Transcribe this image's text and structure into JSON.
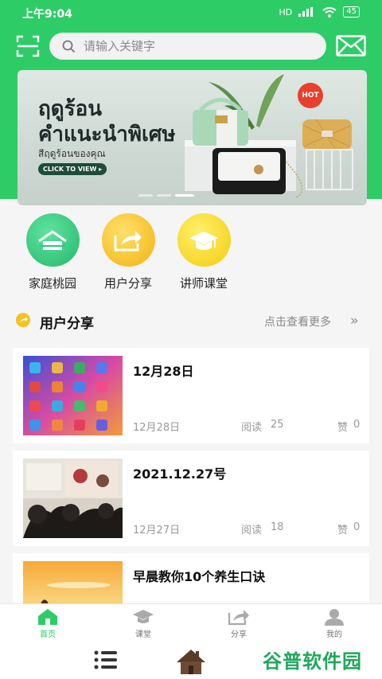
{
  "status_bar": {
    "time": "上午9:04",
    "network": "HD",
    "battery": "45"
  },
  "search": {
    "placeholder": "请输入关键字"
  },
  "banner": {
    "title_line1": "ฤดูร้อน",
    "title_line2": "คำแนะนำพิเศษ",
    "subtitle": "สีฤดูร้อนของคุณ",
    "cta": "CLICK TO VIEW",
    "badge": "HOT"
  },
  "quick_entries": [
    {
      "label": "家庭桃园",
      "icon": "house-icon",
      "color": "#2dc87a"
    },
    {
      "label": "用户分享",
      "icon": "share-icon",
      "color": "#f5be1d"
    },
    {
      "label": "讲师课堂",
      "icon": "graduation-cap-icon",
      "color": "#f5d51d"
    }
  ],
  "section": {
    "title": "用户分享",
    "more": "点击查看更多"
  },
  "posts": [
    {
      "title": "12月28日",
      "date": "12月28日",
      "read_label": "阅读",
      "reads": "25",
      "like_label": "赞",
      "likes": "0"
    },
    {
      "title": "2021.12.27号",
      "date": "12月27日",
      "read_label": "阅读",
      "reads": "18",
      "like_label": "赞",
      "likes": "0"
    },
    {
      "title": "早晨教你10个养生口诀"
    }
  ],
  "bottom_nav": [
    {
      "label": "首页",
      "icon": "home-icon",
      "active": true
    },
    {
      "label": "课堂",
      "icon": "classroom-icon",
      "active": false
    },
    {
      "label": "分享",
      "icon": "share-icon",
      "active": false
    },
    {
      "label": "我的",
      "icon": "profile-icon",
      "active": false
    }
  ],
  "watermark": "谷普软件园",
  "colors": {
    "primary": "#2ecc67",
    "accent_yellow": "#f5c221"
  }
}
